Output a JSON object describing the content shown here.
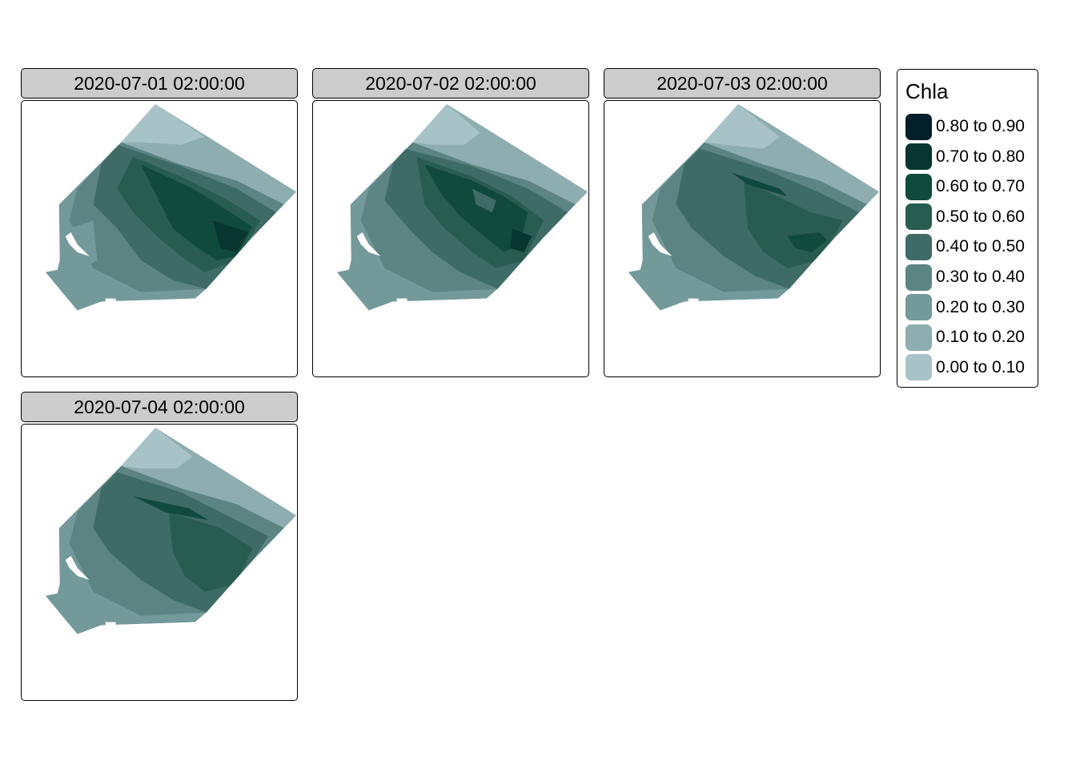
{
  "panels": [
    {
      "title": "2020-07-01 02:00:00"
    },
    {
      "title": "2020-07-02 02:00:00"
    },
    {
      "title": "2020-07-03 02:00:00"
    },
    {
      "title": "2020-07-04 02:00:00"
    }
  ],
  "legend": {
    "title": "Chla",
    "items": [
      {
        "label": "0.80 to 0.90",
        "color": "#03202a"
      },
      {
        "label": "0.70 to 0.80",
        "color": "#06362f"
      },
      {
        "label": "0.60 to 0.70",
        "color": "#0f4a3d"
      },
      {
        "label": "0.50 to 0.60",
        "color": "#285c51"
      },
      {
        "label": "0.40 to 0.50",
        "color": "#3e6b66"
      },
      {
        "label": "0.30 to 0.40",
        "color": "#5b8482"
      },
      {
        "label": "0.20 to 0.30",
        "color": "#73999b"
      },
      {
        "label": "0.10 to 0.20",
        "color": "#8eadb1"
      },
      {
        "label": "0.00 to 0.10",
        "color": "#a8c3c8"
      }
    ]
  }
}
